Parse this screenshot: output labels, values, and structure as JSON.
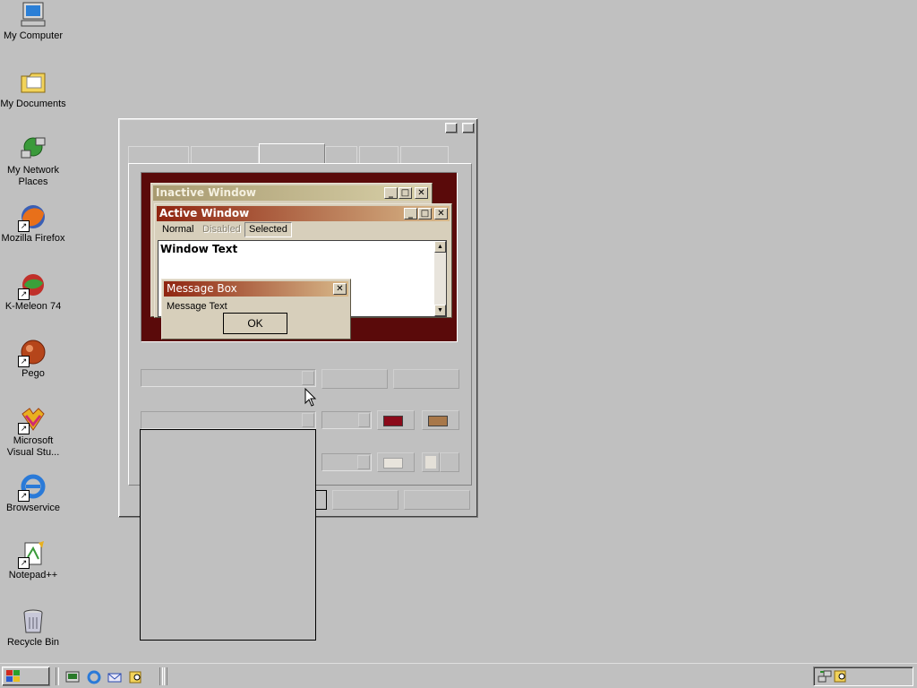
{
  "desktop": {
    "icons": [
      {
        "label": "My Computer",
        "icon": "computer-icon"
      },
      {
        "label": "My Documents",
        "icon": "folder-icon"
      },
      {
        "label": "My Network Places",
        "icon": "network-icon"
      },
      {
        "label": "Mozilla Firefox",
        "icon": "firefox-icon"
      },
      {
        "label": "K-Meleon 74",
        "icon": "kmeleon-icon"
      },
      {
        "label": "Pego",
        "icon": "pego-icon"
      },
      {
        "label": "Microsoft Visual Stu...",
        "icon": "visual-studio-icon"
      },
      {
        "label": "Browservice",
        "icon": "ie-icon"
      },
      {
        "label": "Notepad++",
        "icon": "notepad-icon"
      },
      {
        "label": "Recycle Bin",
        "icon": "recycle-bin-icon"
      }
    ]
  },
  "preview": {
    "inactive_title": "Inactive Window",
    "active_title": "Active Window",
    "menu": {
      "normal": "Normal",
      "disabled": "Disabled",
      "selected": "Selected"
    },
    "window_text": "Window Text",
    "msgbox_title": "Message Box",
    "msgbox_text": "Message Text",
    "ok_label": "OK"
  },
  "colors": {
    "preview_bg": "#5a0a0a",
    "active_title_start": "#8f2410",
    "active_title_end": "#d8b98a",
    "inactive_title_start": "#a89a70",
    "inactive_title_end": "#d8d0a8",
    "color1": "#8b0a1a",
    "color2": "#a8784a"
  }
}
